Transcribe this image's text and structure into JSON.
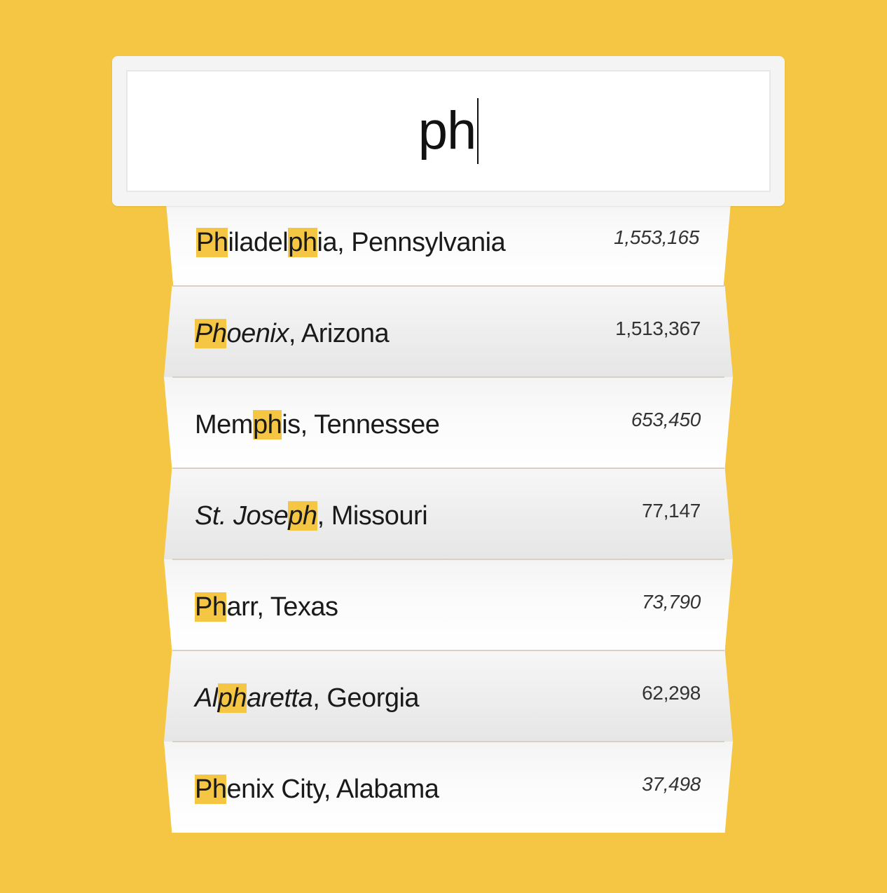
{
  "search": {
    "value": "ph"
  },
  "colors": {
    "background": "#F5C544",
    "highlight": "#F5C544"
  },
  "results": [
    {
      "parts": [
        [
          "Ph",
          true
        ],
        [
          "iladel",
          false
        ],
        [
          "ph",
          true
        ],
        [
          "ia, Pennsylvania",
          false
        ]
      ],
      "population": "1,553,165",
      "italic_population": true,
      "italic_name": false
    },
    {
      "parts": [
        [
          "Ph",
          true
        ],
        [
          "oenix",
          false
        ],
        [
          ", Arizona",
          false
        ]
      ],
      "population": "1,513,367",
      "italic_population": false,
      "italic_name": false,
      "italic_prefix": "Phoenix"
    },
    {
      "parts": [
        [
          "Mem",
          false
        ],
        [
          "ph",
          true
        ],
        [
          "is, Tennessee",
          false
        ]
      ],
      "population": "653,450",
      "italic_population": true,
      "italic_name": false
    },
    {
      "parts": [
        [
          "St. Jose",
          false
        ],
        [
          "ph",
          true
        ],
        [
          ", Missouri",
          false
        ]
      ],
      "population": "77,147",
      "italic_population": false,
      "italic_name": false,
      "italic_prefix": "St. Joseph"
    },
    {
      "parts": [
        [
          "Ph",
          true
        ],
        [
          "arr, Texas",
          false
        ]
      ],
      "population": "73,790",
      "italic_population": true,
      "italic_name": false
    },
    {
      "parts": [
        [
          "Al",
          false
        ],
        [
          "ph",
          true
        ],
        [
          "aretta",
          false
        ],
        [
          ", Georgia",
          false
        ]
      ],
      "population": "62,298",
      "italic_population": false,
      "italic_name": false,
      "italic_prefix": "Alpharetta"
    },
    {
      "parts": [
        [
          "Ph",
          true
        ],
        [
          "enix City, Alabama",
          false
        ]
      ],
      "population": "37,498",
      "italic_population": true,
      "italic_name": false
    }
  ]
}
